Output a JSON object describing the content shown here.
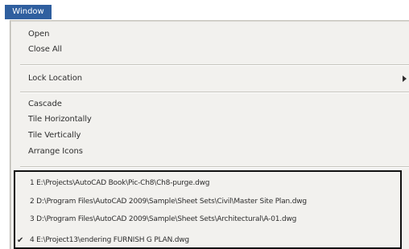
{
  "menu_title": "Window",
  "items": {
    "open": "Open",
    "close_all": "Close All",
    "lock_location": "Lock Location",
    "cascade": "Cascade",
    "tile_horizontally": "Tile Horizontally",
    "tile_vertically": "Tile Vertically",
    "arrange_icons": "Arrange Icons"
  },
  "recent_files": [
    "1 E:\\Projects\\AutoCAD Book\\Pic-Ch8\\Ch8-purge.dwg",
    "2 D:\\Program Files\\AutoCAD 2009\\Sample\\Sheet Sets\\Civil\\Master Site Plan.dwg",
    "3 D:\\Program Files\\AutoCAD 2009\\Sample\\Sheet Sets\\Architectural\\A-01.dwg",
    "4 E:\\Project13\\endering FURNISH G PLAN.dwg"
  ],
  "checkmark": "✔"
}
